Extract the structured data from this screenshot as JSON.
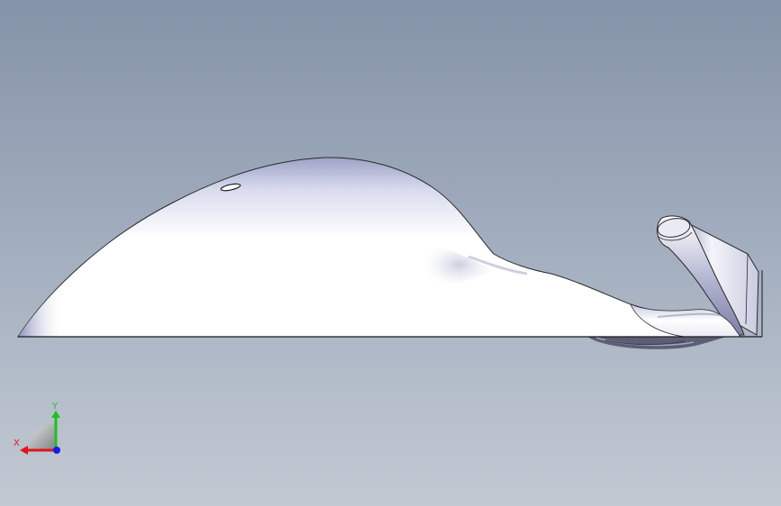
{
  "viewport": {
    "background_top": "#8593a8",
    "background_bottom": "#c3c9d3"
  },
  "model": {
    "name": "aerodynamic-shell",
    "shell_color": "#ffffff",
    "shade_color": "#b6b9d6",
    "edge_color": "#1a1a1a"
  },
  "triad": {
    "x_label": "X",
    "y_label": "Y",
    "x_color": "#e0161b",
    "y_color": "#1cc21c",
    "z_color": "#1a1ae6"
  }
}
